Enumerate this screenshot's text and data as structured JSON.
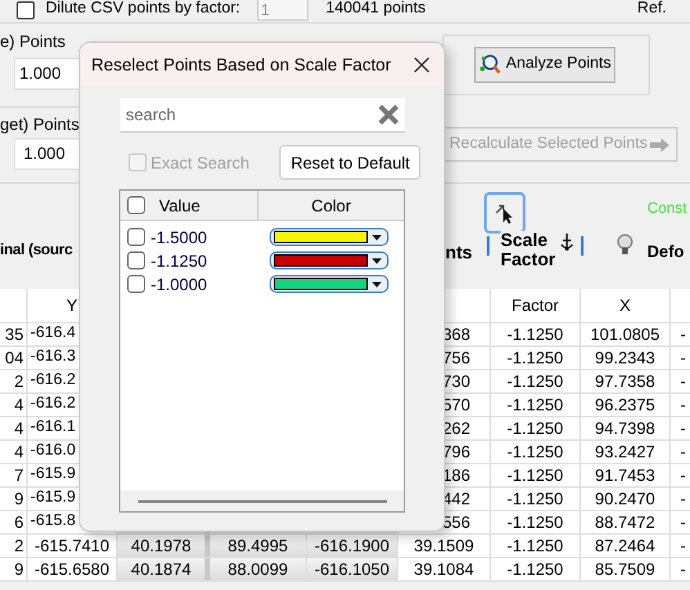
{
  "top_bar": {
    "dilute_checkbox": {
      "label": "Dilute CSV points by factor:",
      "checked": false
    },
    "factor_value": "1",
    "point_count": "140041 points",
    "ref_label": "Ref."
  },
  "source_group": {
    "label": "e) Points",
    "value": "1.000"
  },
  "analyze_button": "Analyze Points",
  "target_group": {
    "label": "get) Points",
    "value": "1.000"
  },
  "recalculate_button": {
    "label": "Recalculate Selected Points",
    "disabled": true
  },
  "status_text": "Const",
  "tool_button": {
    "selected": true
  },
  "section_headers": {
    "left": "inal (sourc",
    "middle": "nts",
    "scale_factor": "Scale Factor",
    "right": "Defo"
  },
  "table": {
    "columns": [
      null,
      "Y",
      null,
      null,
      null,
      null,
      "Factor",
      "X",
      null
    ],
    "rows": [
      [
        "35",
        "-616.4",
        null,
        null,
        null,
        "368",
        "-1.1250",
        "101.0805",
        "-"
      ],
      [
        "04",
        "-616.3",
        null,
        null,
        null,
        "756",
        "-1.1250",
        "99.2343",
        "-"
      ],
      [
        "2",
        "-616.2",
        null,
        null,
        null,
        "730",
        "-1.1250",
        "97.7358",
        "-"
      ],
      [
        "4",
        "-616.2",
        null,
        null,
        null,
        "570",
        "-1.1250",
        "96.2375",
        "-"
      ],
      [
        "4",
        "-616.1",
        null,
        null,
        null,
        "262",
        "-1.1250",
        "94.7398",
        "-"
      ],
      [
        "4",
        "-616.0",
        null,
        null,
        null,
        "796",
        "-1.1250",
        "93.2427",
        "-"
      ],
      [
        "7",
        "-615.9",
        null,
        null,
        null,
        "186",
        "-1.1250",
        "91.7453",
        "-"
      ],
      [
        "9",
        "-615.9",
        null,
        null,
        null,
        "442",
        "-1.1250",
        "90.2470",
        "-"
      ],
      [
        "6",
        "-615.8",
        null,
        null,
        null,
        "556",
        "-1.1250",
        "88.7472",
        "-"
      ],
      [
        "2",
        "-615.7410",
        "40.1978",
        "89.4995",
        "-616.1900",
        "39.1509",
        "-1.1250",
        "87.2464",
        "-"
      ],
      [
        "9",
        "-615.6580",
        "40.1874",
        "88.0099",
        "-616.1050",
        "39.1084",
        "-1.1250",
        "85.7509",
        "-"
      ]
    ]
  },
  "dialog": {
    "title": "Reselect Points Based on Scale Factor",
    "search": {
      "placeholder": "search"
    },
    "exact_search": {
      "label": "Exact Search",
      "checked": false,
      "disabled": true
    },
    "reset_button": "Reset to Default",
    "list": {
      "columns": [
        "Value",
        "Color"
      ],
      "select_all_checked": false,
      "items": [
        {
          "value": "-1.5000",
          "color": "#f5f500",
          "checked": false
        },
        {
          "value": "-1.1250",
          "color": "#c80000",
          "checked": false
        },
        {
          "value": "-1.0000",
          "color": "#17d27d",
          "checked": false
        }
      ]
    }
  }
}
